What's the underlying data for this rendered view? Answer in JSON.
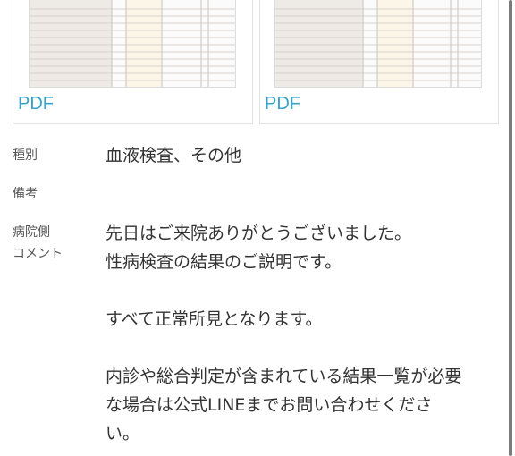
{
  "attachments": [
    {
      "link_label": "PDF"
    },
    {
      "link_label": "PDF"
    }
  ],
  "fields": {
    "type_label": "種別",
    "type_value": "血液検査、その他",
    "remarks_label": "備考",
    "remarks_value": "",
    "comment_label_line1": "病院側",
    "comment_label_line2": "コメント",
    "comment_lines": [
      "先日はご来院ありがとうございました。",
      "性病検査の結果のご説明です。",
      "",
      "すべて正常所見となります。",
      "",
      "内診や総合判定が含まれている結果一覧が必要",
      "な場合は公式LINEまでお問い合わせくださ",
      "い。"
    ]
  },
  "colors": {
    "link": "#36a3c9",
    "text": "#333333",
    "label": "#555555",
    "border": "#e3e3e3"
  }
}
